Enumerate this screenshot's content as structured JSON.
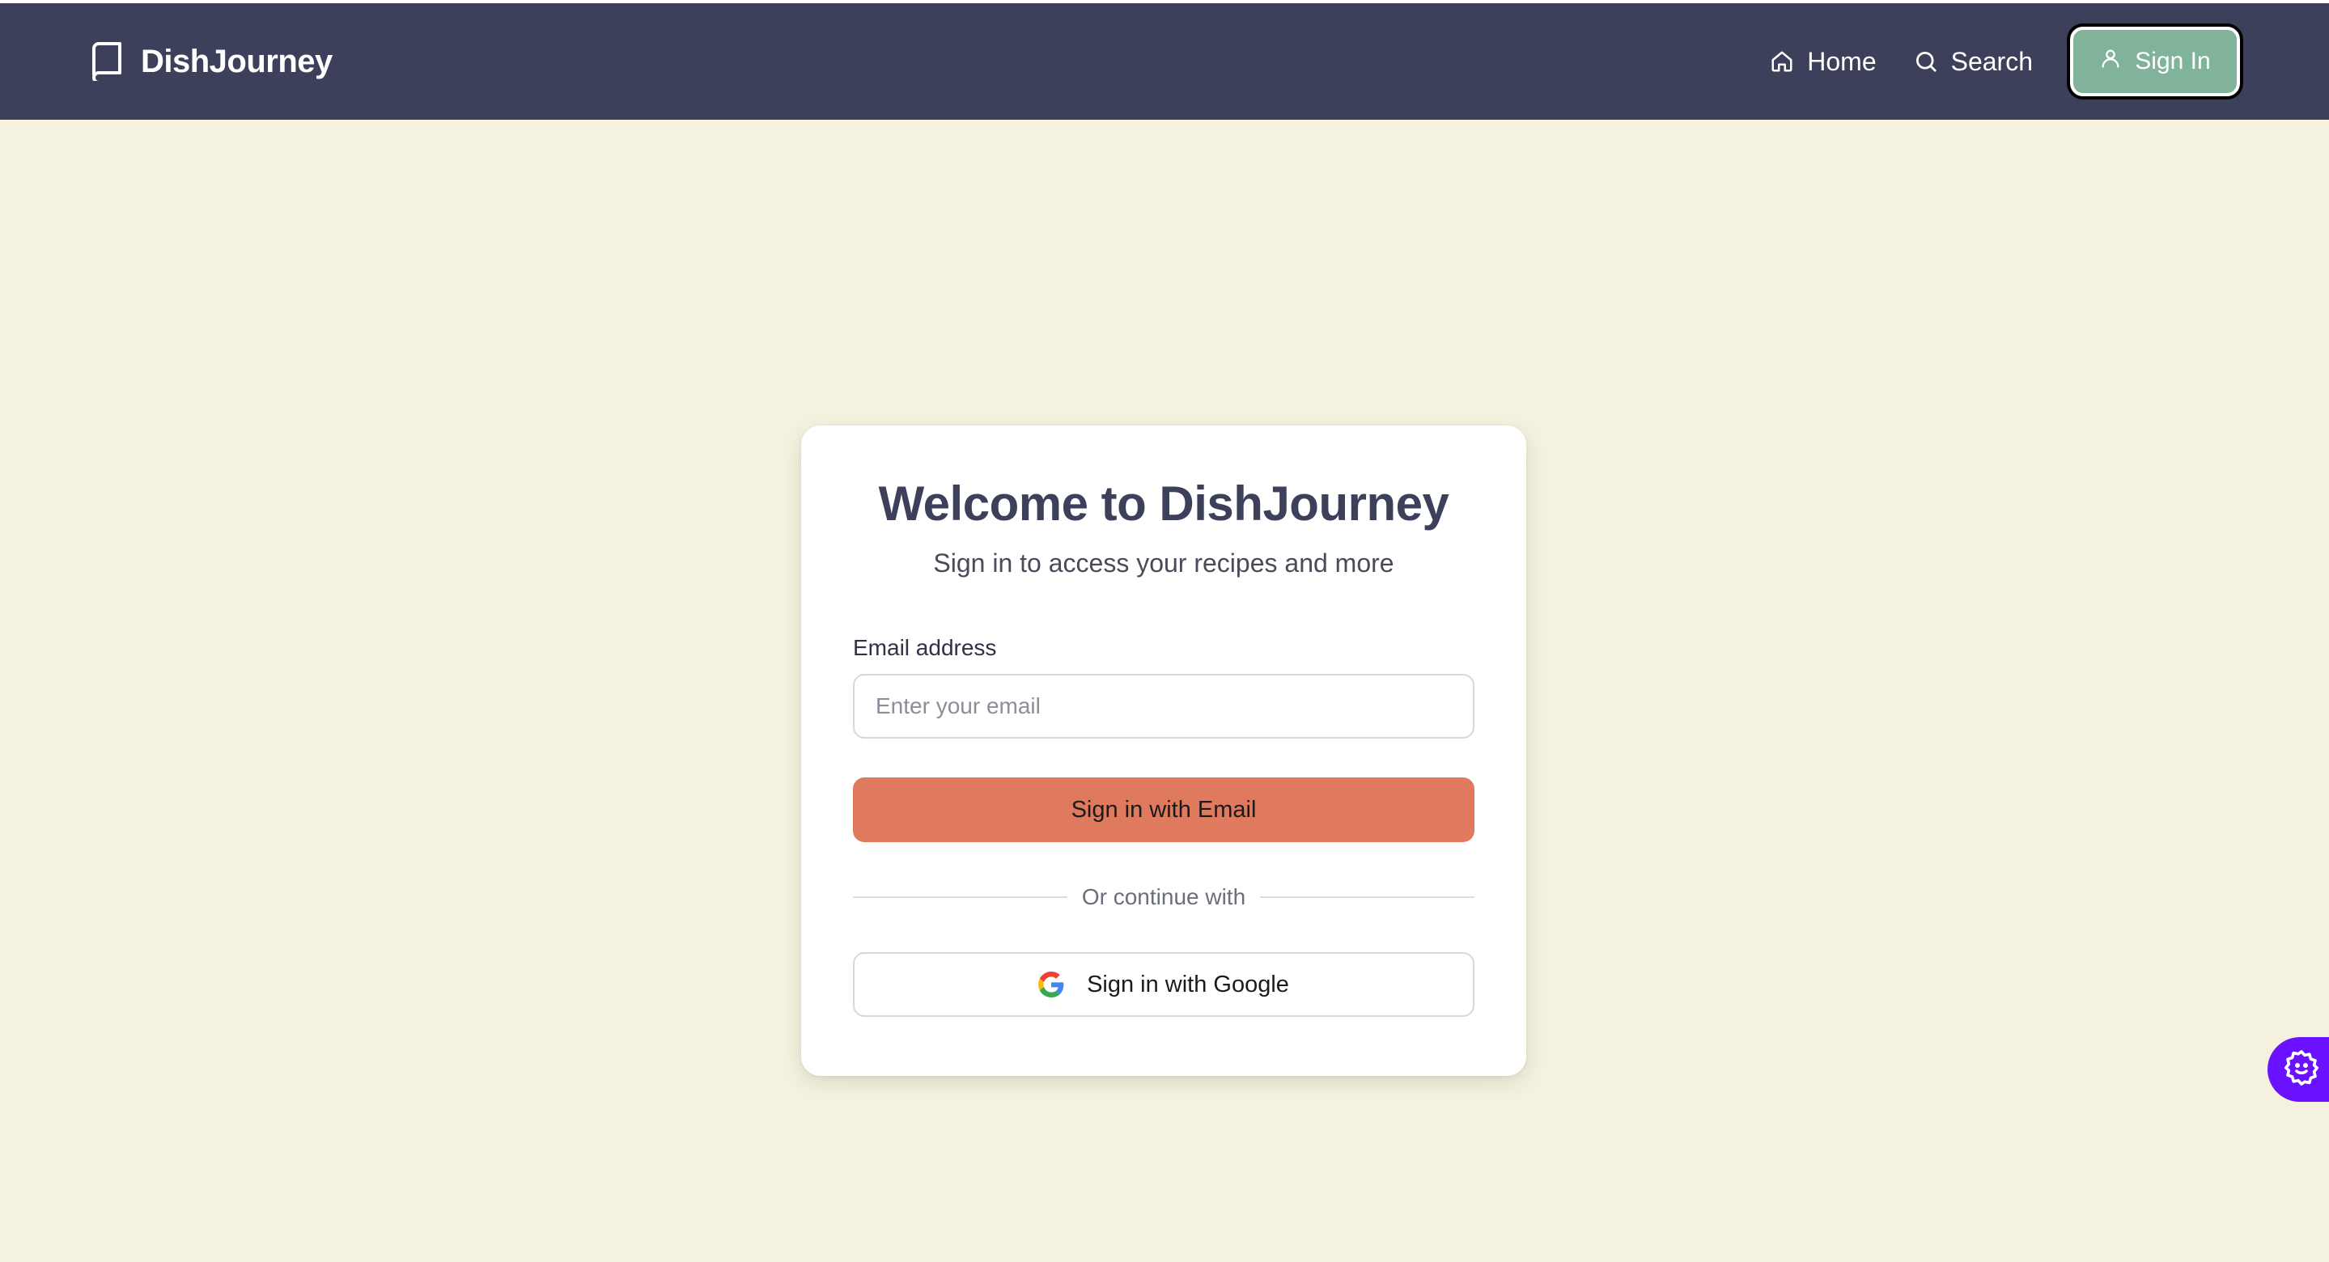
{
  "header": {
    "brand_name": "DishJourney",
    "nav": [
      {
        "label": "Home",
        "icon": "home-icon"
      },
      {
        "label": "Search",
        "icon": "search-icon"
      }
    ],
    "signin_label": "Sign In"
  },
  "card": {
    "title": "Welcome to DishJourney",
    "subtitle": "Sign in to access your recipes and more",
    "email_label": "Email address",
    "email_value": "",
    "email_placeholder": "Enter your email",
    "email_button": "Sign in with Email",
    "divider_text": "Or continue with",
    "google_button": "Sign in with Google"
  },
  "colors": {
    "navbar": "#3d405b",
    "background": "#f4f1de",
    "accent_primary": "#e07a5f",
    "accent_secondary": "#81b29a",
    "widget": "#6a11ff"
  },
  "widget": {
    "icon": "gear-smile-icon"
  }
}
